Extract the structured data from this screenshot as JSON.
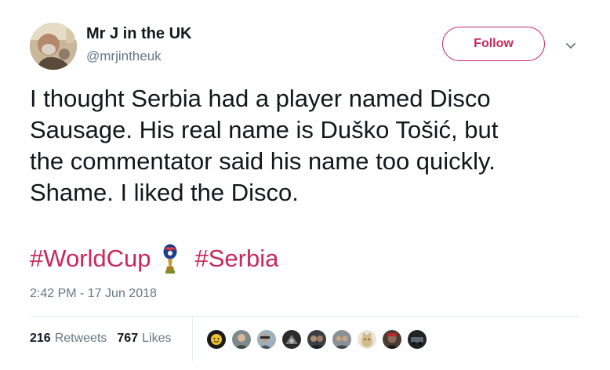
{
  "user": {
    "display_name": "Mr J in the UK",
    "handle": "@mrjintheuk"
  },
  "follow_button": {
    "label": "Follow"
  },
  "tweet": {
    "lines": [
      "I thought Serbia had a player named Disco",
      "Sausage. His real name is Duško Tošić, but",
      "the commentator said his name too quickly.",
      "Shame. I liked the Disco."
    ],
    "hashtags": [
      "#WorldCup",
      "#Serbia"
    ],
    "timestamp": "2:42 PM - 17 Jun 2018"
  },
  "stats": {
    "retweets_count": "216",
    "retweets_label": "Retweets",
    "likes_count": "767",
    "likes_label": "Likes"
  },
  "icons": {
    "caret": "chevron-down-icon",
    "hashtag_emoji": "world-cup-trophy-icon"
  },
  "colors": {
    "accent": "#c8285a",
    "text": "#14171a",
    "muted": "#657786",
    "divider": "#e6ecf0"
  }
}
